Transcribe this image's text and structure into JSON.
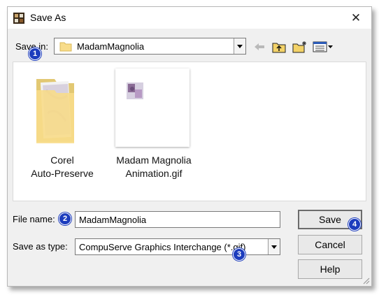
{
  "window": {
    "title": "Save As"
  },
  "save_in": {
    "label": "Save in:",
    "value": "MadamMagnolia"
  },
  "toolbar": {
    "icons": [
      "back-arrow-icon",
      "up-folder-icon",
      "new-folder-icon",
      "view-menu-icon"
    ]
  },
  "files": [
    {
      "line1": "Corel",
      "line2": "Auto-Preserve",
      "type": "folder"
    },
    {
      "line1": "Madam Magnolia",
      "line2": "Animation.gif",
      "type": "gif"
    }
  ],
  "file_name": {
    "label": "File name:",
    "value": "MadamMagnolia"
  },
  "save_as_type": {
    "label": "Save as type:",
    "value": "CompuServe Graphics Interchange (*.gif)"
  },
  "buttons": {
    "save": "Save",
    "cancel": "Cancel",
    "help": "Help"
  },
  "badges": [
    "1",
    "2",
    "3",
    "4"
  ],
  "colors": {
    "badge": "#1c3cbd",
    "folder": "#f8dc8a"
  }
}
